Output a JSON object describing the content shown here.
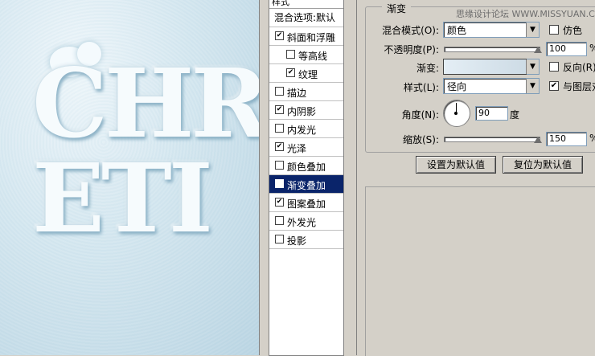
{
  "canvas": {
    "letters_row1": "CHR",
    "letters_row2": "ETI"
  },
  "styles_panel": {
    "header": "样式",
    "blend_options": "混合选项:默认",
    "items": [
      {
        "label": "斜面和浮雕",
        "checked": "✔",
        "sub": false,
        "selected": false
      },
      {
        "label": "等高线",
        "checked": "",
        "sub": true,
        "selected": false
      },
      {
        "label": "纹理",
        "checked": "✔",
        "sub": true,
        "selected": false
      },
      {
        "label": "描边",
        "checked": "",
        "sub": false,
        "selected": false
      },
      {
        "label": "内阴影",
        "checked": "✔",
        "sub": false,
        "selected": false
      },
      {
        "label": "内发光",
        "checked": "",
        "sub": false,
        "selected": false
      },
      {
        "label": "光泽",
        "checked": "✔",
        "sub": false,
        "selected": false
      },
      {
        "label": "颜色叠加",
        "checked": "",
        "sub": false,
        "selected": false
      },
      {
        "label": "渐变叠加",
        "checked": "✔",
        "sub": false,
        "selected": true
      },
      {
        "label": "图案叠加",
        "checked": "✔",
        "sub": false,
        "selected": false
      },
      {
        "label": "外发光",
        "checked": "",
        "sub": false,
        "selected": false
      },
      {
        "label": "投影",
        "checked": "",
        "sub": false,
        "selected": false
      }
    ]
  },
  "gradient_overlay": {
    "group_title": "渐变",
    "watermark": "思缘设计论坛 WWW.MISSYUAN.COM",
    "blend_mode_label": "混合模式(O):",
    "blend_mode_value": "颜色",
    "dither_label": "仿色",
    "dither_checked": "",
    "opacity_label": "不透明度(P):",
    "opacity_value": "100",
    "opacity_unit": "%",
    "gradient_label": "渐变:",
    "reverse_label": "反向(R)",
    "reverse_checked": "",
    "style_label": "样式(L):",
    "style_value": "径向",
    "align_label": "与图层对齐",
    "align_checked": "✔",
    "angle_label": "角度(N):",
    "angle_value": "90",
    "angle_unit": "度",
    "scale_label": "缩放(S):",
    "scale_value": "150",
    "scale_unit": "%",
    "make_default": "设置为默认值",
    "reset_default": "复位为默认值"
  }
}
